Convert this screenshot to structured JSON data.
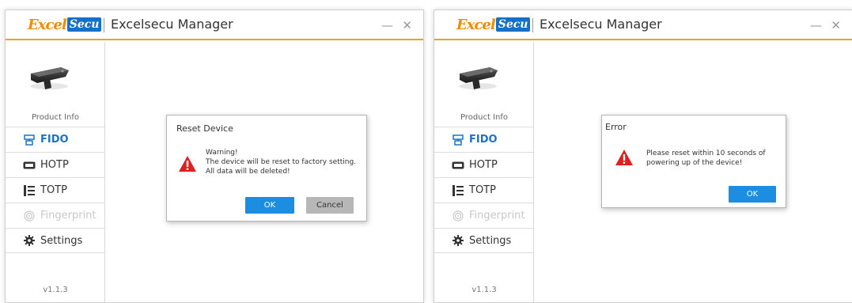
{
  "windows": [
    {
      "logo": {
        "part1": "Excel",
        "part2": "Secu"
      },
      "app_title": "Excelsecu Manager",
      "controls": {
        "minimize": "—",
        "close": "✕"
      },
      "sidebar": {
        "product_info": "Product Info",
        "items": [
          {
            "label": "FIDO",
            "icon": "fido-icon",
            "state": "active"
          },
          {
            "label": "HOTP",
            "icon": "hotp-icon",
            "state": "normal"
          },
          {
            "label": "TOTP",
            "icon": "totp-icon",
            "state": "normal"
          },
          {
            "label": "Fingerprint",
            "icon": "fingerprint-icon",
            "state": "disabled"
          },
          {
            "label": "Settings",
            "icon": "gear-icon",
            "state": "normal"
          }
        ],
        "version": "v1.1.3"
      },
      "dialog": {
        "title": "Reset Device",
        "message_lines": [
          "Warning!",
          "The device will be reset to factory setting.",
          "All data will be deleted!"
        ],
        "ok_label": "OK",
        "cancel_label": "Cancel"
      }
    },
    {
      "logo": {
        "part1": "Excel",
        "part2": "Secu"
      },
      "app_title": "Excelsecu Manager",
      "controls": {
        "minimize": "—",
        "close": "✕"
      },
      "sidebar": {
        "product_info": "Product Info",
        "items": [
          {
            "label": "FIDO",
            "icon": "fido-icon",
            "state": "active"
          },
          {
            "label": "HOTP",
            "icon": "hotp-icon",
            "state": "normal"
          },
          {
            "label": "TOTP",
            "icon": "totp-icon",
            "state": "normal"
          },
          {
            "label": "Fingerprint",
            "icon": "fingerprint-icon",
            "state": "disabled"
          },
          {
            "label": "Settings",
            "icon": "gear-icon",
            "state": "normal"
          }
        ],
        "version": "v1.1.3"
      },
      "dialog": {
        "title": "Error",
        "message_lines": [
          "Please reset within 10 seconds of",
          "powering up of the device!"
        ],
        "ok_label": "OK"
      }
    }
  ],
  "colors": {
    "accent": "#1a73c9",
    "logo_orange": "#f08c00",
    "logo_blue": "#1570c8",
    "title_underline": "#f0a020",
    "warning_red": "#e02020",
    "ok_button": "#1c8de0"
  }
}
